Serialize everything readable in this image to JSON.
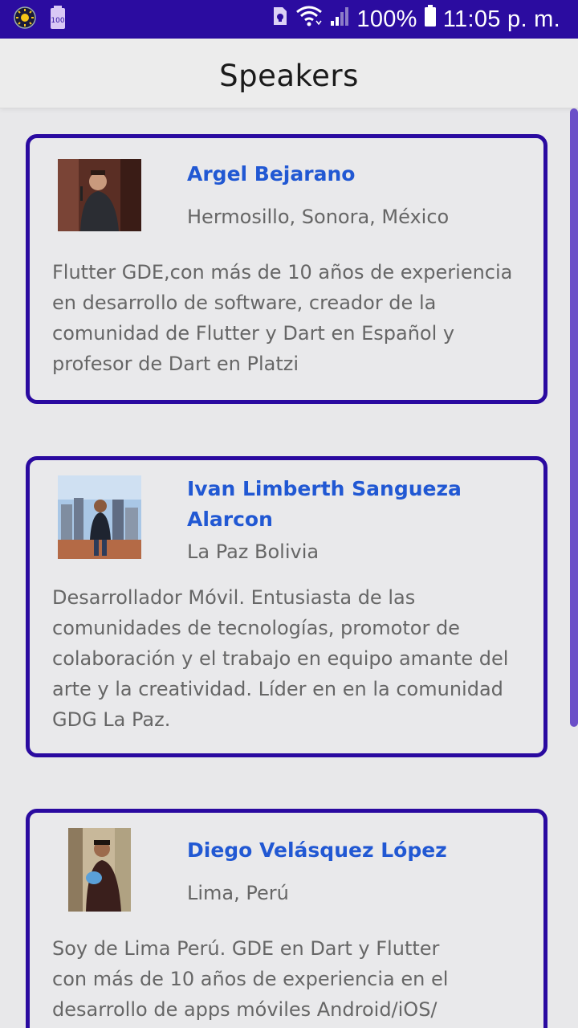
{
  "status_bar": {
    "battery_saver_badge": "100",
    "battery_percent": "100%",
    "time": "11:05 p. m."
  },
  "app_bar": {
    "title": "Speakers"
  },
  "speakers": [
    {
      "name": "Argel Bejarano",
      "location": "Hermosillo, Sonora, México",
      "bio": "Flutter GDE,con más de 10 años de experiencia en desarrollo de software, creador de la comunidad de Flutter y Dart en Español y profesor de Dart en Platzi"
    },
    {
      "name": "Ivan Limberth Sangueza Alarcon",
      "location": "La Paz Bolivia",
      "bio": "Desarrollador Móvil. Entusiasta de las comunidades de tecnologías, promotor de colaboración y el trabajo en equipo amante del arte y la creatividad. Líder en en la comunidad GDG La Paz."
    },
    {
      "name": "Diego Velásquez López",
      "location": "Lima, Perú",
      "bio": "Soy de Lima Perú. GDE en Dart y Flutter con más de 10 años de experiencia en el desarrollo de apps móviles Android/iOS/"
    }
  ]
}
